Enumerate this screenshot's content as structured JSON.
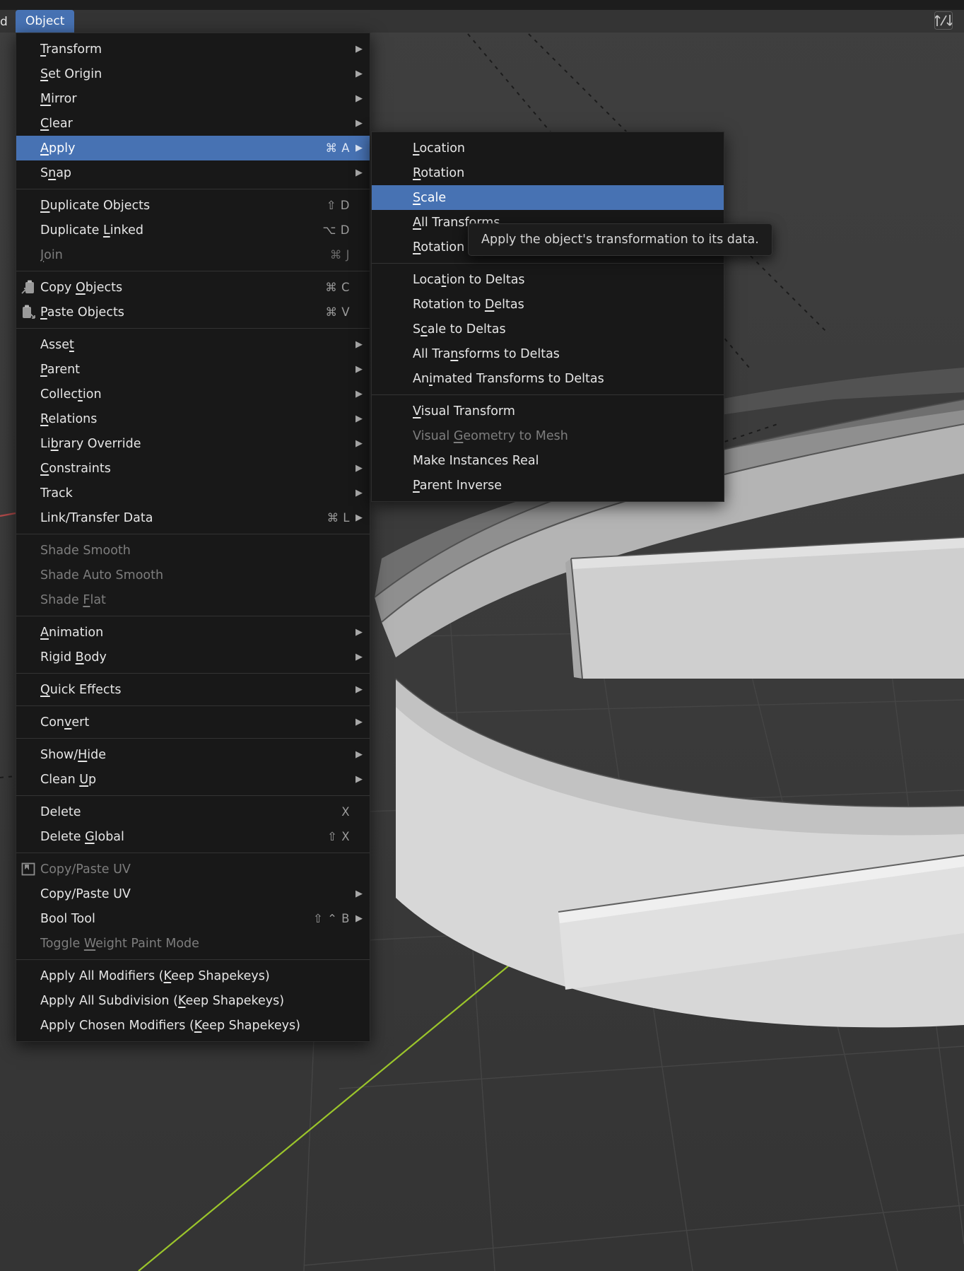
{
  "app": {
    "menubar": {
      "left_truncated_label": "d",
      "active_menu": "Object",
      "gizmo_icon": "orientation-gizmo-icon"
    }
  },
  "colors": {
    "accent_highlight": "#4772b3",
    "menu_background": "#181818",
    "menu_text": "#e6e6e6",
    "disabled_text": "#7d7d7d",
    "viewport_background": "#3a3a3a",
    "axis_green": "#9bc52b",
    "axis_red": "#b24a4a"
  },
  "main_menu": {
    "name": "Object",
    "groups": [
      {
        "items": [
          {
            "label": "Transform",
            "accel": "T",
            "shortcut": "",
            "submenu": true,
            "icon": "",
            "disabled": false,
            "selected": false
          },
          {
            "label": "Set Origin",
            "accel": "S",
            "shortcut": "",
            "submenu": true,
            "icon": "",
            "disabled": false,
            "selected": false
          },
          {
            "label": "Mirror",
            "accel": "M",
            "shortcut": "",
            "submenu": true,
            "icon": "",
            "disabled": false,
            "selected": false
          },
          {
            "label": "Clear",
            "accel": "C",
            "shortcut": "",
            "submenu": true,
            "icon": "",
            "disabled": false,
            "selected": false
          },
          {
            "label": "Apply",
            "accel": "A",
            "shortcut": "⌘ A",
            "submenu": true,
            "icon": "",
            "disabled": false,
            "selected": true
          },
          {
            "label": "Snap",
            "accel": "n",
            "shortcut": "",
            "submenu": true,
            "icon": "",
            "disabled": false,
            "selected": false
          }
        ]
      },
      {
        "items": [
          {
            "label": "Duplicate Objects",
            "accel": "D",
            "shortcut": "⇧ D",
            "submenu": false,
            "icon": "",
            "disabled": false,
            "selected": false
          },
          {
            "label": "Duplicate Linked",
            "accel": "L",
            "shortcut": "⌥ D",
            "submenu": false,
            "icon": "",
            "disabled": false,
            "selected": false
          },
          {
            "label": "Join",
            "accel": "J",
            "shortcut": "⌘ J",
            "submenu": false,
            "icon": "",
            "disabled": true,
            "selected": false
          }
        ]
      },
      {
        "items": [
          {
            "label": "Copy Objects",
            "accel": "O",
            "shortcut": "⌘ C",
            "submenu": false,
            "icon": "copy-clipboard-icon",
            "disabled": false,
            "selected": false
          },
          {
            "label": "Paste Objects",
            "accel": "P",
            "shortcut": "⌘ V",
            "submenu": false,
            "icon": "paste-clipboard-icon",
            "disabled": false,
            "selected": false
          }
        ]
      },
      {
        "items": [
          {
            "label": "Asset",
            "accel": "t",
            "shortcut": "",
            "submenu": true,
            "icon": "",
            "disabled": false,
            "selected": false
          },
          {
            "label": "Parent",
            "accel": "P",
            "shortcut": "",
            "submenu": true,
            "icon": "",
            "disabled": false,
            "selected": false
          },
          {
            "label": "Collection",
            "accel": "t",
            "shortcut": "",
            "submenu": true,
            "icon": "",
            "disabled": false,
            "selected": false
          },
          {
            "label": "Relations",
            "accel": "R",
            "shortcut": "",
            "submenu": true,
            "icon": "",
            "disabled": false,
            "selected": false
          },
          {
            "label": "Library Override",
            "accel": "b",
            "shortcut": "",
            "submenu": true,
            "icon": "",
            "disabled": false,
            "selected": false
          },
          {
            "label": "Constraints",
            "accel": "C",
            "shortcut": "",
            "submenu": true,
            "icon": "",
            "disabled": false,
            "selected": false
          },
          {
            "label": "Track",
            "accel": "",
            "shortcut": "",
            "submenu": true,
            "icon": "",
            "disabled": false,
            "selected": false
          },
          {
            "label": "Link/Transfer Data",
            "accel": "",
            "shortcut": "⌘ L",
            "submenu": true,
            "icon": "",
            "disabled": false,
            "selected": false
          }
        ]
      },
      {
        "items": [
          {
            "label": "Shade Smooth",
            "accel": "",
            "shortcut": "",
            "submenu": false,
            "icon": "",
            "disabled": true,
            "selected": false
          },
          {
            "label": "Shade Auto Smooth",
            "accel": "",
            "shortcut": "",
            "submenu": false,
            "icon": "",
            "disabled": true,
            "selected": false
          },
          {
            "label": "Shade Flat",
            "accel": "F",
            "shortcut": "",
            "submenu": false,
            "icon": "",
            "disabled": true,
            "selected": false
          }
        ]
      },
      {
        "items": [
          {
            "label": "Animation",
            "accel": "A",
            "shortcut": "",
            "submenu": true,
            "icon": "",
            "disabled": false,
            "selected": false
          },
          {
            "label": "Rigid Body",
            "accel": "B",
            "shortcut": "",
            "submenu": true,
            "icon": "",
            "disabled": false,
            "selected": false
          }
        ]
      },
      {
        "items": [
          {
            "label": "Quick Effects",
            "accel": "Q",
            "shortcut": "",
            "submenu": true,
            "icon": "",
            "disabled": false,
            "selected": false
          }
        ]
      },
      {
        "items": [
          {
            "label": "Convert",
            "accel": "v",
            "shortcut": "",
            "submenu": true,
            "icon": "",
            "disabled": false,
            "selected": false
          }
        ]
      },
      {
        "items": [
          {
            "label": "Show/Hide",
            "accel": "H",
            "shortcut": "",
            "submenu": true,
            "icon": "",
            "disabled": false,
            "selected": false
          },
          {
            "label": "Clean Up",
            "accel": "U",
            "shortcut": "",
            "submenu": true,
            "icon": "",
            "disabled": false,
            "selected": false
          }
        ]
      },
      {
        "items": [
          {
            "label": "Delete",
            "accel": "",
            "shortcut": "X",
            "submenu": false,
            "icon": "",
            "disabled": false,
            "selected": false
          },
          {
            "label": "Delete Global",
            "accel": "G",
            "shortcut": "⇧ X",
            "submenu": false,
            "icon": "",
            "disabled": false,
            "selected": false
          }
        ]
      },
      {
        "items": [
          {
            "label": "Copy/Paste UV",
            "accel": "",
            "shortcut": "",
            "submenu": false,
            "icon": "uv-addon-icon",
            "disabled": true,
            "selected": false
          },
          {
            "label": "Copy/Paste UV",
            "accel": "",
            "shortcut": "",
            "submenu": true,
            "icon": "",
            "disabled": false,
            "selected": false
          },
          {
            "label": "Bool Tool",
            "accel": "",
            "shortcut": "⇧ ⌃ B",
            "submenu": true,
            "icon": "",
            "disabled": false,
            "selected": false
          },
          {
            "label": "Toggle Weight Paint Mode",
            "accel": "W",
            "shortcut": "",
            "submenu": false,
            "icon": "",
            "disabled": true,
            "selected": false
          }
        ]
      },
      {
        "items": [
          {
            "label": "Apply All Modifiers (Keep Shapekeys)",
            "accel": "K",
            "shortcut": "",
            "submenu": false,
            "icon": "",
            "disabled": false,
            "selected": false
          },
          {
            "label": "Apply All Subdivision (Keep Shapekeys)",
            "accel": "K",
            "shortcut": "",
            "submenu": false,
            "icon": "",
            "disabled": false,
            "selected": false
          },
          {
            "label": "Apply Chosen Modifiers (Keep Shapekeys)",
            "accel": "K",
            "shortcut": "",
            "submenu": false,
            "icon": "",
            "disabled": false,
            "selected": false
          }
        ]
      }
    ]
  },
  "apply_submenu": {
    "parent": "Apply",
    "groups": [
      {
        "items": [
          {
            "label": "Location",
            "accel": "L",
            "disabled": false,
            "selected": false
          },
          {
            "label": "Rotation",
            "accel": "R",
            "disabled": false,
            "selected": false
          },
          {
            "label": "Scale",
            "accel": "S",
            "disabled": false,
            "selected": true
          },
          {
            "label": "All Transforms",
            "accel": "A",
            "disabled": false,
            "selected": false
          },
          {
            "label": "Rotation",
            "accel": "R",
            "disabled": false,
            "selected": false
          }
        ]
      },
      {
        "items": [
          {
            "label": "Location to Deltas",
            "accel": "t",
            "disabled": false,
            "selected": false
          },
          {
            "label": "Rotation to Deltas",
            "accel": "D",
            "disabled": false,
            "selected": false
          },
          {
            "label": "Scale to Deltas",
            "accel": "c",
            "disabled": false,
            "selected": false
          },
          {
            "label": "All Transforms to Deltas",
            "accel": "n",
            "disabled": false,
            "selected": false
          },
          {
            "label": "Animated Transforms to Deltas",
            "accel": "i",
            "disabled": false,
            "selected": false
          }
        ]
      },
      {
        "items": [
          {
            "label": "Visual Transform",
            "accel": "V",
            "disabled": false,
            "selected": false
          },
          {
            "label": "Visual Geometry to Mesh",
            "accel": "G",
            "disabled": true,
            "selected": false
          },
          {
            "label": "Make Instances Real",
            "accel": "",
            "disabled": false,
            "selected": false
          },
          {
            "label": "Parent Inverse",
            "accel": "P",
            "disabled": false,
            "selected": false
          }
        ]
      }
    ]
  },
  "tooltip": {
    "text": "Apply the object's transformation to its data."
  }
}
